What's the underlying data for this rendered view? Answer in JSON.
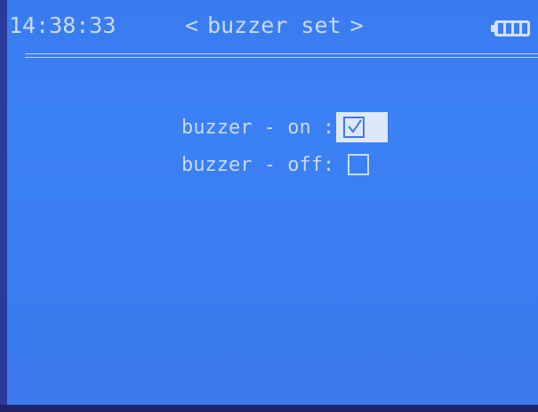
{
  "status_bar": {
    "time": "14:38:33",
    "battery_icon": "battery-full-icon"
  },
  "header": {
    "prev_arrow": "<",
    "title": "buzzer set",
    "next_arrow": ">"
  },
  "settings": {
    "options": [
      {
        "label": "buzzer - on :",
        "checked": true,
        "selected": true
      },
      {
        "label": "buzzer - off:",
        "checked": false,
        "selected": false
      }
    ]
  },
  "colors": {
    "screen_background": "#3a7ef2",
    "text": "#c9d9f7",
    "selection_highlight": "#dde8fb"
  }
}
